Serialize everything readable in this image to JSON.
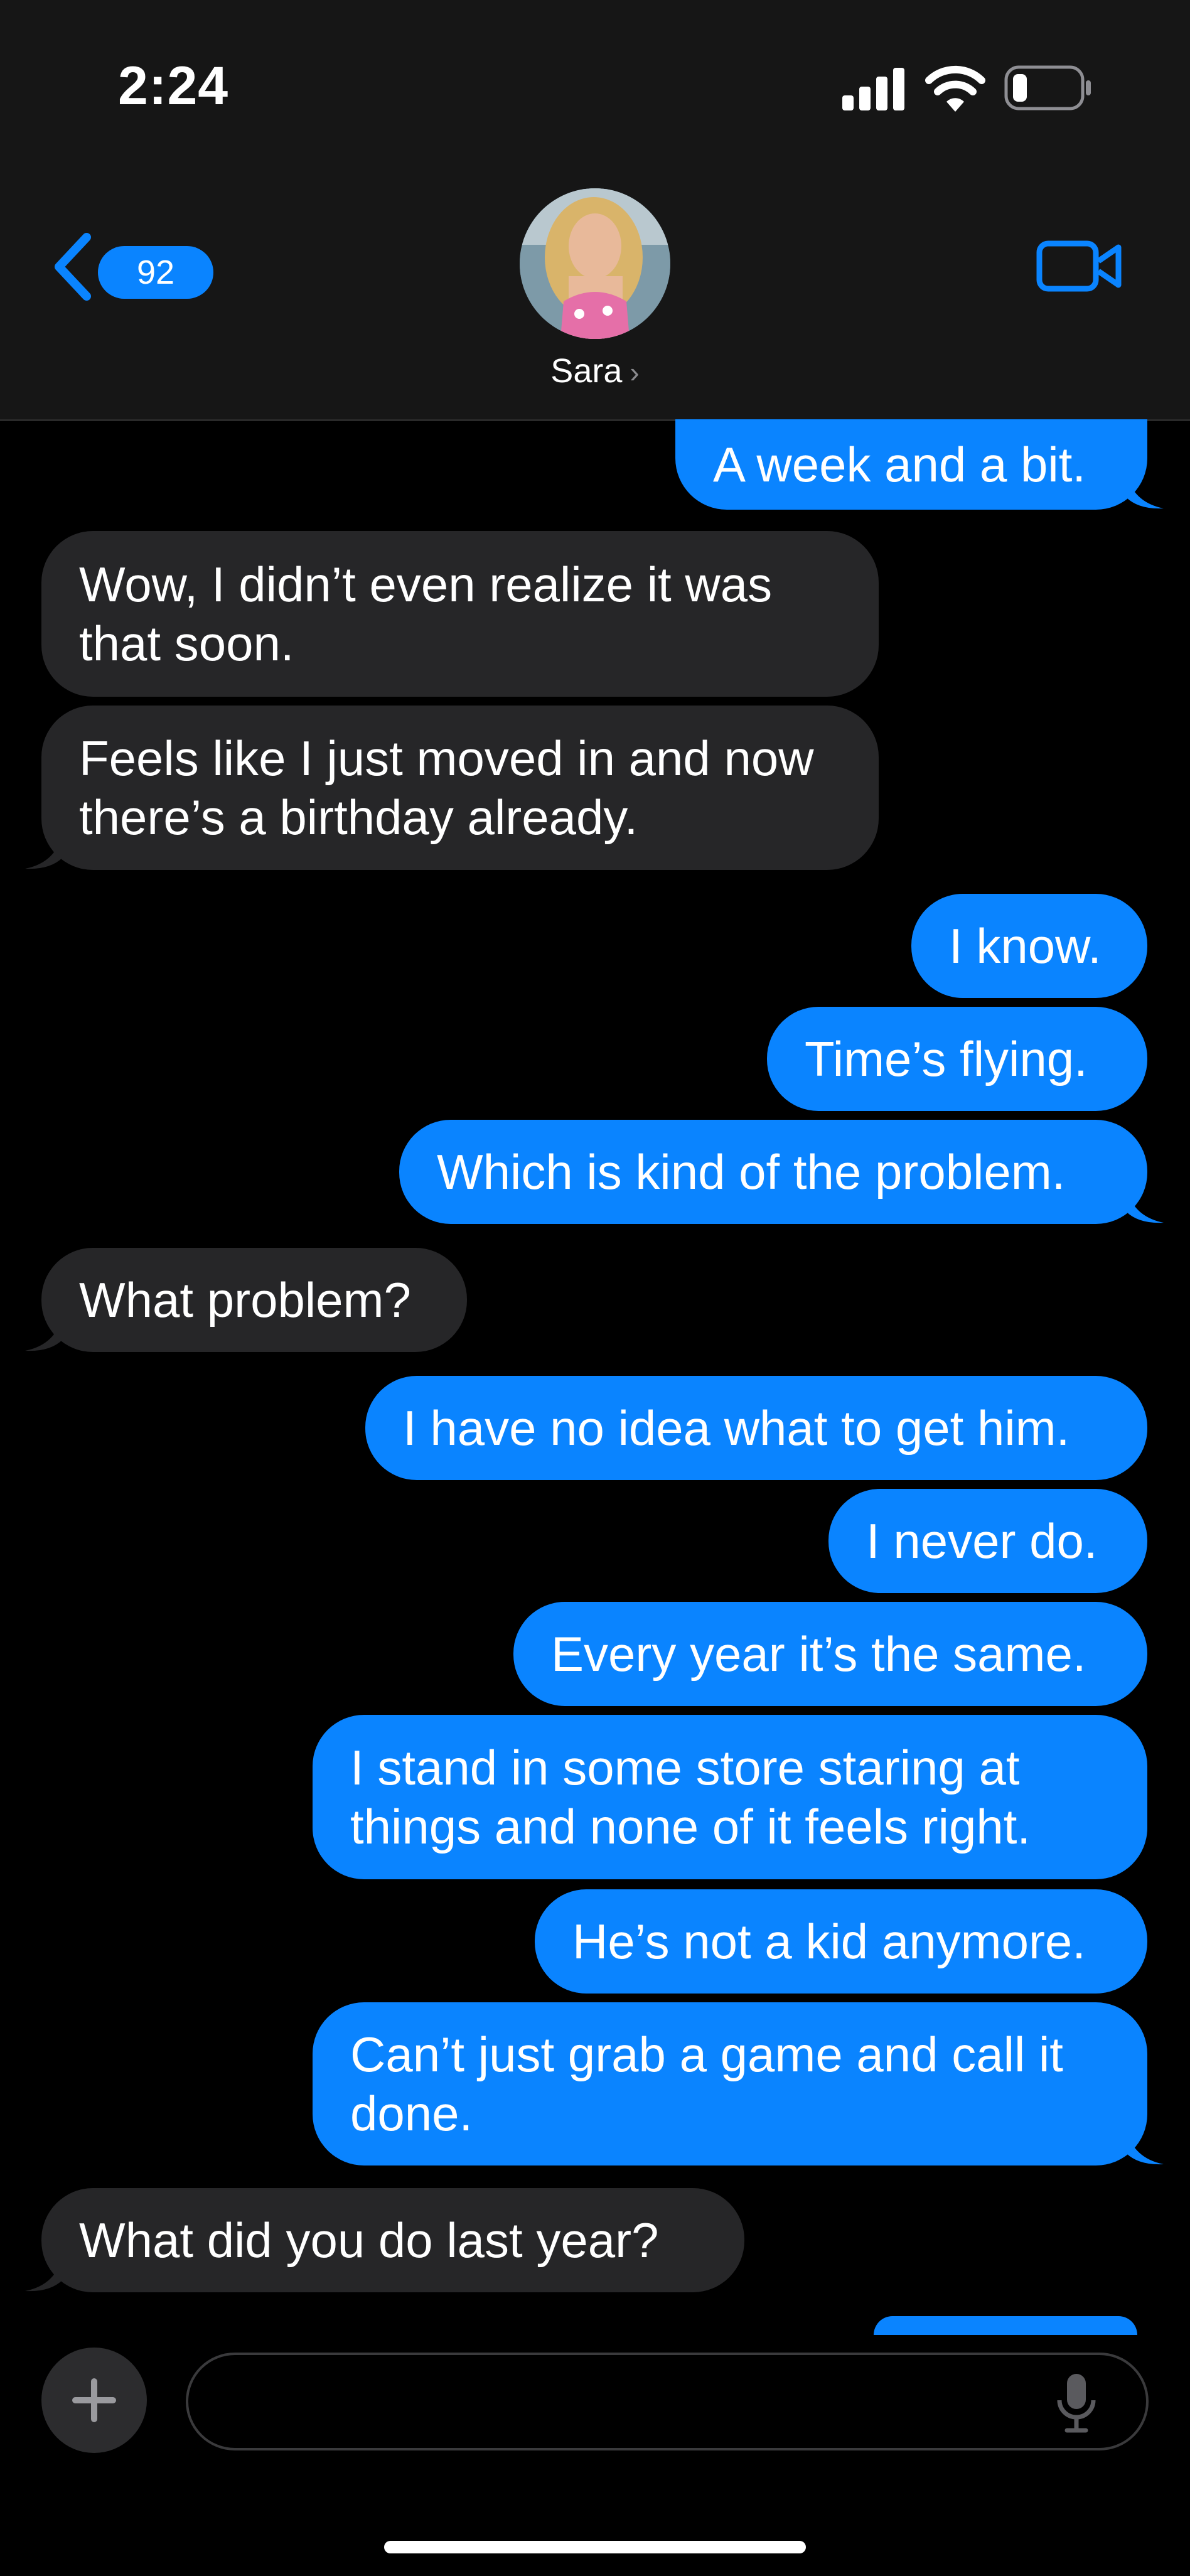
{
  "status": {
    "time": "2:24"
  },
  "header": {
    "back_count": "92",
    "contact_name": "Sara",
    "contact_chevron": "›"
  },
  "messages": [
    {
      "dir": "out",
      "text": "A week and a bit."
    },
    {
      "dir": "in",
      "text": "Wow, I didn’t even realize it was that soon."
    },
    {
      "dir": "in",
      "text": "Feels like I just moved in and now there’s a birthday already."
    },
    {
      "dir": "out",
      "text": "I know."
    },
    {
      "dir": "out",
      "text": "Time’s flying."
    },
    {
      "dir": "out",
      "text": "Which is kind of the problem."
    },
    {
      "dir": "in",
      "text": "What problem?"
    },
    {
      "dir": "out",
      "text": "I have no idea what to get him."
    },
    {
      "dir": "out",
      "text": "I never do."
    },
    {
      "dir": "out",
      "text": "Every year it’s the same."
    },
    {
      "dir": "out",
      "text": "I stand in some store staring at things and none of it feels right."
    },
    {
      "dir": "out",
      "text": "He’s not a kid anymore."
    },
    {
      "dir": "out",
      "text": "Can’t just grab a game and call it done."
    },
    {
      "dir": "in",
      "text": "What did you do last year?"
    }
  ],
  "colors": {
    "outgoing": "#0a84ff",
    "incoming": "#262628",
    "background": "#000000",
    "header": "#161616"
  },
  "icons": [
    "back-chevron-icon",
    "video-camera-icon",
    "plus-icon",
    "microphone-icon",
    "signal-icon",
    "wifi-icon",
    "battery-icon"
  ]
}
